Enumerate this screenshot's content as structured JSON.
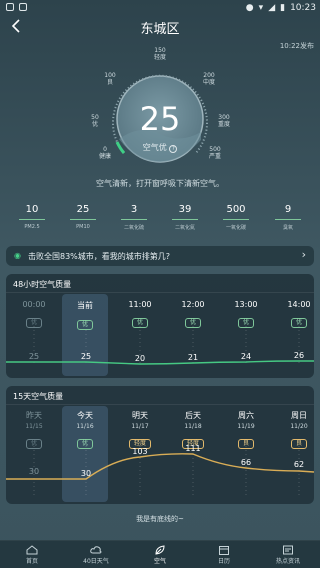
{
  "status_bar": {
    "time": "10:23"
  },
  "header": {
    "title": "东城区",
    "publish_time": "10:22发布"
  },
  "gauge": {
    "aqi": "25",
    "level": "空气优",
    "scale": [
      {
        "value": "0",
        "label": "健康"
      },
      {
        "value": "50",
        "label": "优"
      },
      {
        "value": "100",
        "label": "良"
      },
      {
        "value": "150",
        "label": "轻度"
      },
      {
        "value": "200",
        "label": "中度"
      },
      {
        "value": "300",
        "label": "重度"
      },
      {
        "value": "500",
        "label": "严重"
      }
    ],
    "accent": "#3fcf86"
  },
  "tip": "空气清新，打开窗呼吸下清新空气。",
  "pollutants": [
    {
      "value": "10",
      "name": "PM2.5"
    },
    {
      "value": "25",
      "name": "PM10"
    },
    {
      "value": "3",
      "name": "二氧化硫"
    },
    {
      "value": "39",
      "name": "二氧化氮"
    },
    {
      "value": "500",
      "name": "一氧化碳"
    },
    {
      "value": "9",
      "name": "臭氧"
    }
  ],
  "rank_banner": "击败全国83%城市，看我的城市排第几?",
  "hourly": {
    "title": "48小时空气质量",
    "items": [
      {
        "time": "00:00",
        "level": "优",
        "value": "25"
      },
      {
        "time": "当前",
        "level": "优",
        "value": "25"
      },
      {
        "time": "11:00",
        "level": "优",
        "value": "20"
      },
      {
        "time": "12:00",
        "level": "优",
        "value": "21"
      },
      {
        "time": "13:00",
        "level": "优",
        "value": "24"
      },
      {
        "time": "14:00",
        "level": "优",
        "value": "26"
      }
    ]
  },
  "daily": {
    "title": "15天空气质量",
    "items": [
      {
        "day": "昨天",
        "date": "11/15",
        "level": "优",
        "value": "30"
      },
      {
        "day": "今天",
        "date": "11/16",
        "level": "优",
        "value": "30"
      },
      {
        "day": "明天",
        "date": "11/17",
        "level": "轻度",
        "value": "103"
      },
      {
        "day": "后天",
        "date": "11/18",
        "level": "轻度",
        "value": "111"
      },
      {
        "day": "周六",
        "date": "11/19",
        "level": "良",
        "value": "66"
      },
      {
        "day": "周日",
        "date": "11/20",
        "level": "良",
        "value": "62"
      }
    ]
  },
  "footer_note": "我是有底线的~",
  "tabs": [
    {
      "label": "首页",
      "icon": "home-icon"
    },
    {
      "label": "40日天气",
      "icon": "cloud-icon"
    },
    {
      "label": "空气",
      "icon": "leaf-icon"
    },
    {
      "label": "日历",
      "icon": "calendar-icon"
    },
    {
      "label": "热点资讯",
      "icon": "news-icon"
    }
  ]
}
